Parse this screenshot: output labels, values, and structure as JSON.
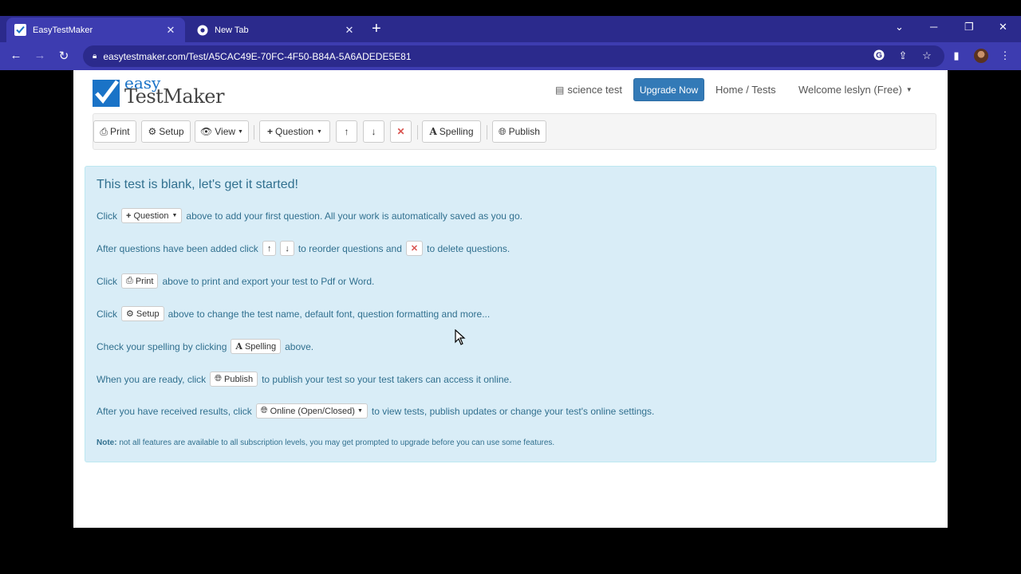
{
  "browser": {
    "tabs": [
      {
        "label": "EasyTestMaker",
        "active": true
      },
      {
        "label": "New Tab",
        "active": false
      }
    ],
    "url": "easytestmaker.com/Test/A5CAC49E-70FC-4F50-B84A-5A6ADEDE5E81"
  },
  "header": {
    "logo_easy": "easy",
    "logo_name": "TestMaker",
    "doc_link": "science test",
    "upgrade_label": "Upgrade Now",
    "home_link": "Home / Tests",
    "welcome": "Welcome leslyn (Free)"
  },
  "toolbar": {
    "print": "Print",
    "setup": "Setup",
    "view": "View",
    "question": "Question",
    "spelling": "Spelling",
    "publish": "Publish"
  },
  "alert": {
    "title": "This test is blank, let's get it started!",
    "l1_pre": "Click",
    "l1_btn": "Question",
    "l1_post": "above to add your first question. All your work is automatically saved as you go.",
    "l2_pre": "After questions have been added click",
    "l2_mid": "to reorder questions and",
    "l2_post": "to delete questions.",
    "l3_pre": "Click",
    "l3_btn": "Print",
    "l3_post": "above to print and export your test to Pdf or Word.",
    "l4_pre": "Click",
    "l4_btn": "Setup",
    "l4_post": "above to change the test name, default font, question formatting and more...",
    "l5_pre": "Check your spelling by clicking",
    "l5_btn": "Spelling",
    "l5_post": "above.",
    "l6_pre": "When you are ready, click",
    "l6_btn": "Publish",
    "l6_post": "to publish your test so your test takers can access it online.",
    "l7_pre": "After you have received results, click",
    "l7_btn": "Online (Open/Closed)",
    "l7_post": "to view tests, publish updates or change your test's online settings.",
    "note_label": "Note:",
    "note_text": "not all features are available to all subscription levels, you may get prompted to upgrade before you can use some features."
  }
}
